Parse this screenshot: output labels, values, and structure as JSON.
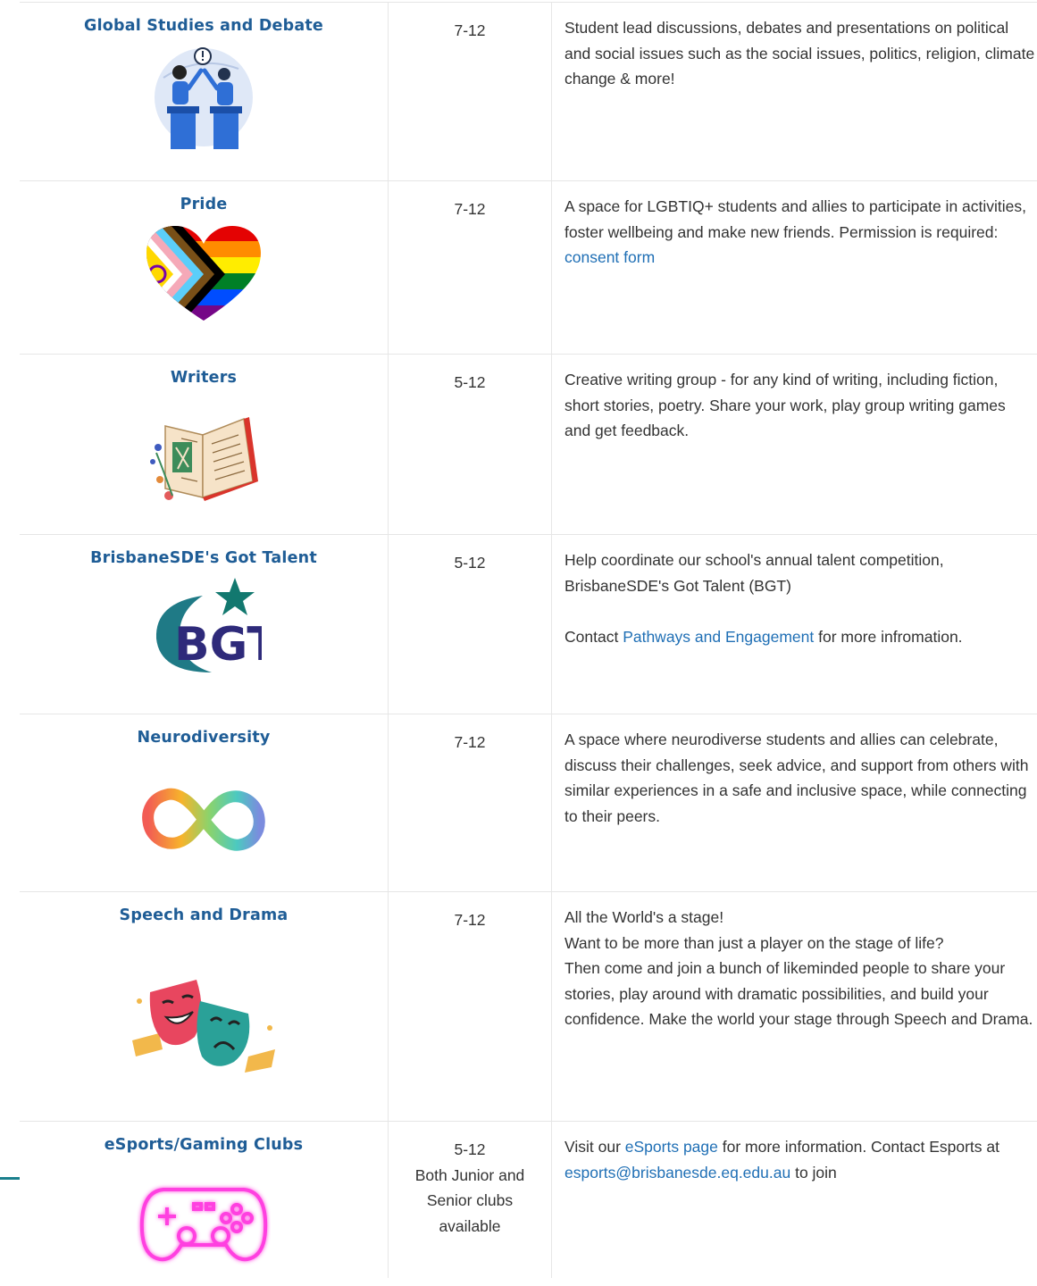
{
  "colors": {
    "club_title": "#1f5d96",
    "link": "#1f6fb5",
    "text": "#333333",
    "border": "#e6e6e6",
    "accent_line": "#1a7f8c"
  },
  "clubs": [
    {
      "name": "Global Studies and Debate",
      "icon": "debate-podiums-icon",
      "years": "7-12",
      "description": "Student lead discussions, debates and presentations on political and social issues such as the social issues, politics, religion, climate change & more!"
    },
    {
      "name": "Pride",
      "icon": "pride-heart-icon",
      "years": "7-12",
      "description_before": "A space for LGBTIQ+ students and allies to participate in activities, foster wellbeing and make new friends. Permission is required: ",
      "link": "consent form"
    },
    {
      "name": "Writers",
      "icon": "open-book-icon",
      "years": "5-12",
      "description": "Creative writing group - for any kind of writing, including fiction, short stories, poetry. Share your work, play group writing games and get feedback."
    },
    {
      "name": "BrisbaneSDE's Got Talent",
      "icon": "bgt-logo-icon",
      "logo_text": "BGT",
      "years": "5-12",
      "description_p1": "Help coordinate our school's annual talent competition, BrisbaneSDE's Got Talent (BGT)",
      "description_p2_before": "Contact ",
      "link": "Pathways and Engagement",
      "description_p2_after": " for more infromation."
    },
    {
      "name": "Neurodiversity",
      "icon": "infinity-icon",
      "years": "7-12",
      "description": "A space where neurodiverse students and allies can celebrate, discuss their challenges, seek advice, and support from others with similar experiences in a safe and inclusive space, while connecting to their peers."
    },
    {
      "name": "Speech and Drama",
      "icon": "theatre-masks-icon",
      "years": "7-12",
      "description_lines": [
        "All the World's a stage!",
        "Want to be more than just a player on the stage of life?",
        "Then come and join a bunch of likeminded people to share your stories, play around with dramatic possibilities, and build your confidence. Make the world your stage through Speech and Drama."
      ]
    },
    {
      "name": "eSports/Gaming Clubs",
      "icon": "game-controller-icon",
      "years": "5-12",
      "years_note": "Both Junior and Senior clubs available",
      "description_before": "Visit our ",
      "link": "eSports page",
      "description_middle": " for more information. Contact Esports at ",
      "email": "esports@brisbanesde.eq.edu.au",
      "description_after": " to join"
    }
  ]
}
